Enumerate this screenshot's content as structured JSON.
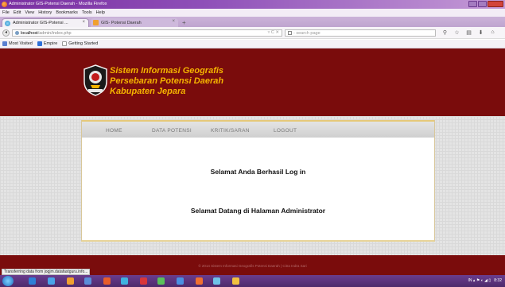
{
  "window": {
    "title": "Administrator GIS-Potensi Daerah - Mozilla Firefox"
  },
  "menubar": [
    "File",
    "Edit",
    "View",
    "History",
    "Bookmarks",
    "Tools",
    "Help"
  ],
  "tabs": [
    {
      "label": "Administrator GIS-Potensi ...",
      "close": "×"
    },
    {
      "label": "GIS- Potensi Daerah",
      "close": "×"
    }
  ],
  "new_tab": "+",
  "address": {
    "host": "localhost",
    "path": "/admin/index.php",
    "controls": "▿ C ✕"
  },
  "search": {
    "placeholder": "- search page"
  },
  "bookmarks": [
    "Most Visited",
    "Empire",
    "Getting Started"
  ],
  "site": {
    "title_lines": [
      "Sistem Informasi Geografis",
      "Persebaran Potensi Daerah",
      "Kabupaten Jepara"
    ],
    "logo_text": "JEPARA",
    "nav": [
      "HOME",
      "DATA POTENSI",
      "KRITIK/SARAN",
      "LOGOUT"
    ],
    "message_login": "Selamat Anda Berhasil Log in",
    "message_welcome": "Selamat Datang di Halaman Administrator",
    "footer": "© 2014 Sistem Informasi Geografis Potensi Daerah | Citra Indra Sari"
  },
  "status_bar": "Transferring data from jogjm.datafastguru.info...",
  "tray": {
    "indicators": "IN  ▴  ⚑  ◐  ◢  ▯",
    "time": "8:32"
  },
  "colors": {
    "header_bg": "#7a0c0c",
    "title_text": "#f5b400",
    "accent_border": "#e6c97a",
    "window_frame": "#8e4fb8"
  }
}
